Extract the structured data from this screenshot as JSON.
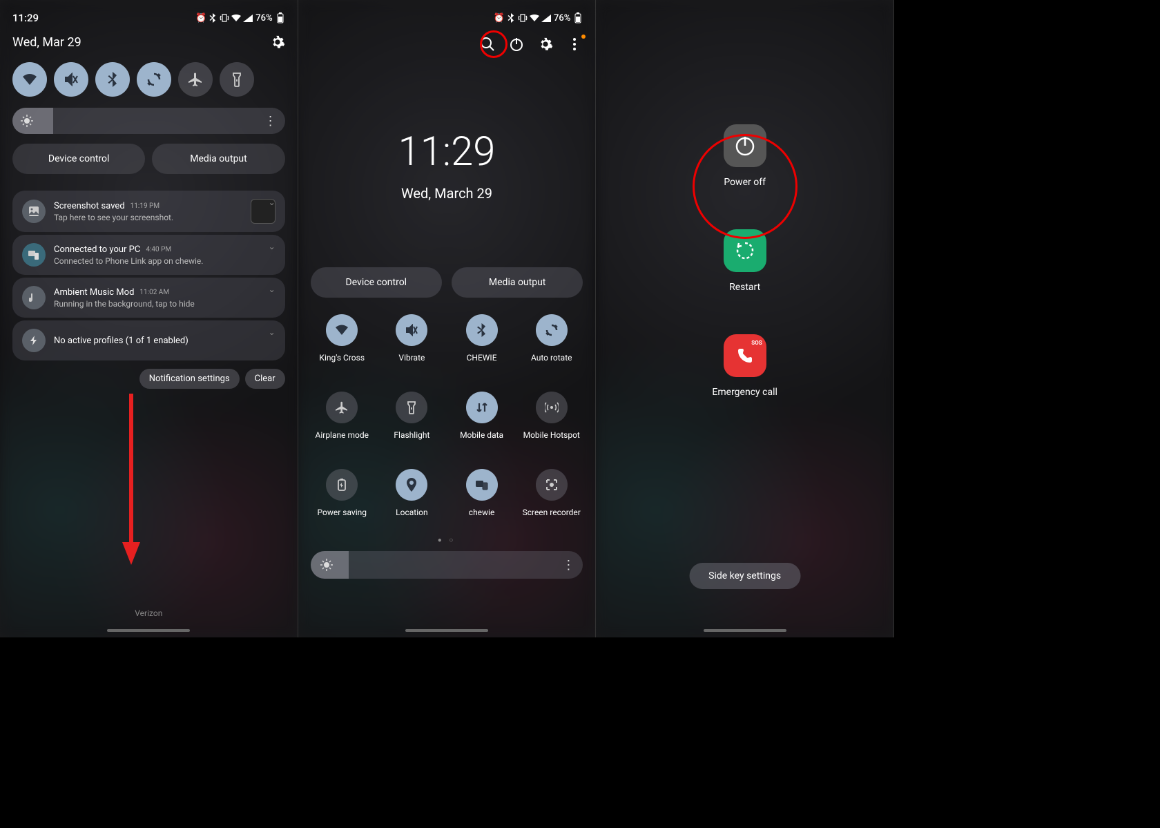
{
  "status": {
    "time": "11:29",
    "battery": "76%"
  },
  "panel1": {
    "date": "Wed, Mar 29",
    "device_control": "Device control",
    "media_output": "Media output",
    "notifications": [
      {
        "title": "Screenshot saved",
        "time": "11:19 PM",
        "sub": "Tap here to see your screenshot.",
        "has_thumb": true
      },
      {
        "title": "Connected to your PC",
        "time": "4:40 PM",
        "sub": "Connected to Phone Link app on chewie."
      },
      {
        "title": "Ambient Music Mod",
        "time": "11:02 AM",
        "sub": "Running in the background, tap to hide"
      },
      {
        "title": "No active profiles (1 of 1 enabled)",
        "time": "",
        "sub": ""
      }
    ],
    "notif_settings": "Notification settings",
    "clear": "Clear",
    "carrier": "Verizon"
  },
  "panel2": {
    "time": "11:29",
    "date": "Wed, March 29",
    "device_control": "Device control",
    "media_output": "Media output",
    "tiles": [
      {
        "label": "King's Cross",
        "on": true,
        "icon": "wifi"
      },
      {
        "label": "Vibrate",
        "on": true,
        "icon": "vibrate"
      },
      {
        "label": "CHEWIE",
        "on": true,
        "icon": "bluetooth"
      },
      {
        "label": "Auto rotate",
        "on": true,
        "icon": "rotate"
      },
      {
        "label": "Airplane mode",
        "on": false,
        "icon": "airplane"
      },
      {
        "label": "Flashlight",
        "on": false,
        "icon": "flashlight"
      },
      {
        "label": "Mobile data",
        "on": true,
        "icon": "data"
      },
      {
        "label": "Mobile Hotspot",
        "on": false,
        "icon": "hotspot"
      },
      {
        "label": "Power saving",
        "on": false,
        "icon": "battery"
      },
      {
        "label": "Location",
        "on": true,
        "icon": "location"
      },
      {
        "label": "chewie",
        "on": true,
        "icon": "link"
      },
      {
        "label": "Screen recorder",
        "on": false,
        "icon": "record"
      }
    ]
  },
  "panel3": {
    "power_off": "Power off",
    "restart": "Restart",
    "emergency": "Emergency call",
    "sos": "SOS",
    "side_key": "Side key settings"
  }
}
